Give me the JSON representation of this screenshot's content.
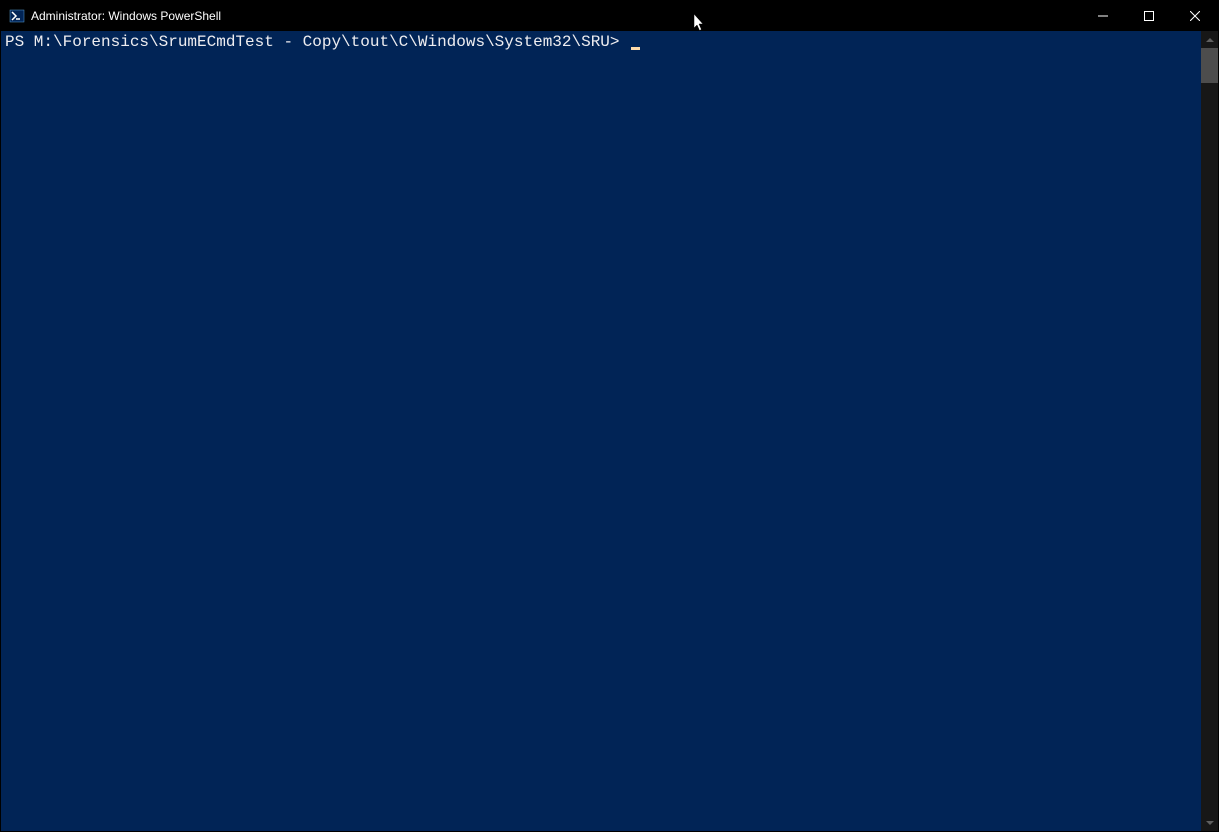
{
  "window": {
    "title": "Administrator: Windows PowerShell"
  },
  "terminal": {
    "prompt": "PS M:\\Forensics\\SrumECmdTest - Copy\\tout\\C\\Windows\\System32\\SRU> "
  },
  "icons": {
    "powershell": "powershell-icon",
    "minimize": "—",
    "maximize": "☐",
    "close": "✕",
    "scroll_up": "⏶",
    "scroll_down": "⏷"
  }
}
